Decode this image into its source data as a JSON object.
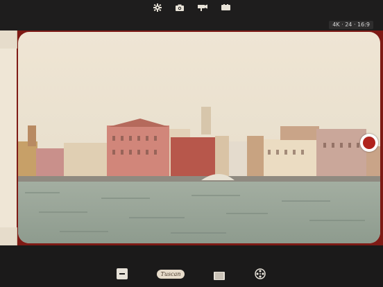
{
  "top_toolbar": {
    "icons": [
      "settings-gear-icon",
      "photo-camera-icon",
      "video-camera-icon",
      "film-format-icon"
    ]
  },
  "format_badge": {
    "label": "4K · 24 · 16:9"
  },
  "viewfinder": {
    "scene": "waterfront-photo",
    "shutter_color": "#b0231d",
    "frame_color": "#7e1a15"
  },
  "bottom_toolbar": {
    "filter_label": "Tuscan",
    "icons": [
      "exposure-minus-icon",
      "filter-style-icon",
      "aspect-frame-icon",
      "film-reel-icon"
    ]
  }
}
